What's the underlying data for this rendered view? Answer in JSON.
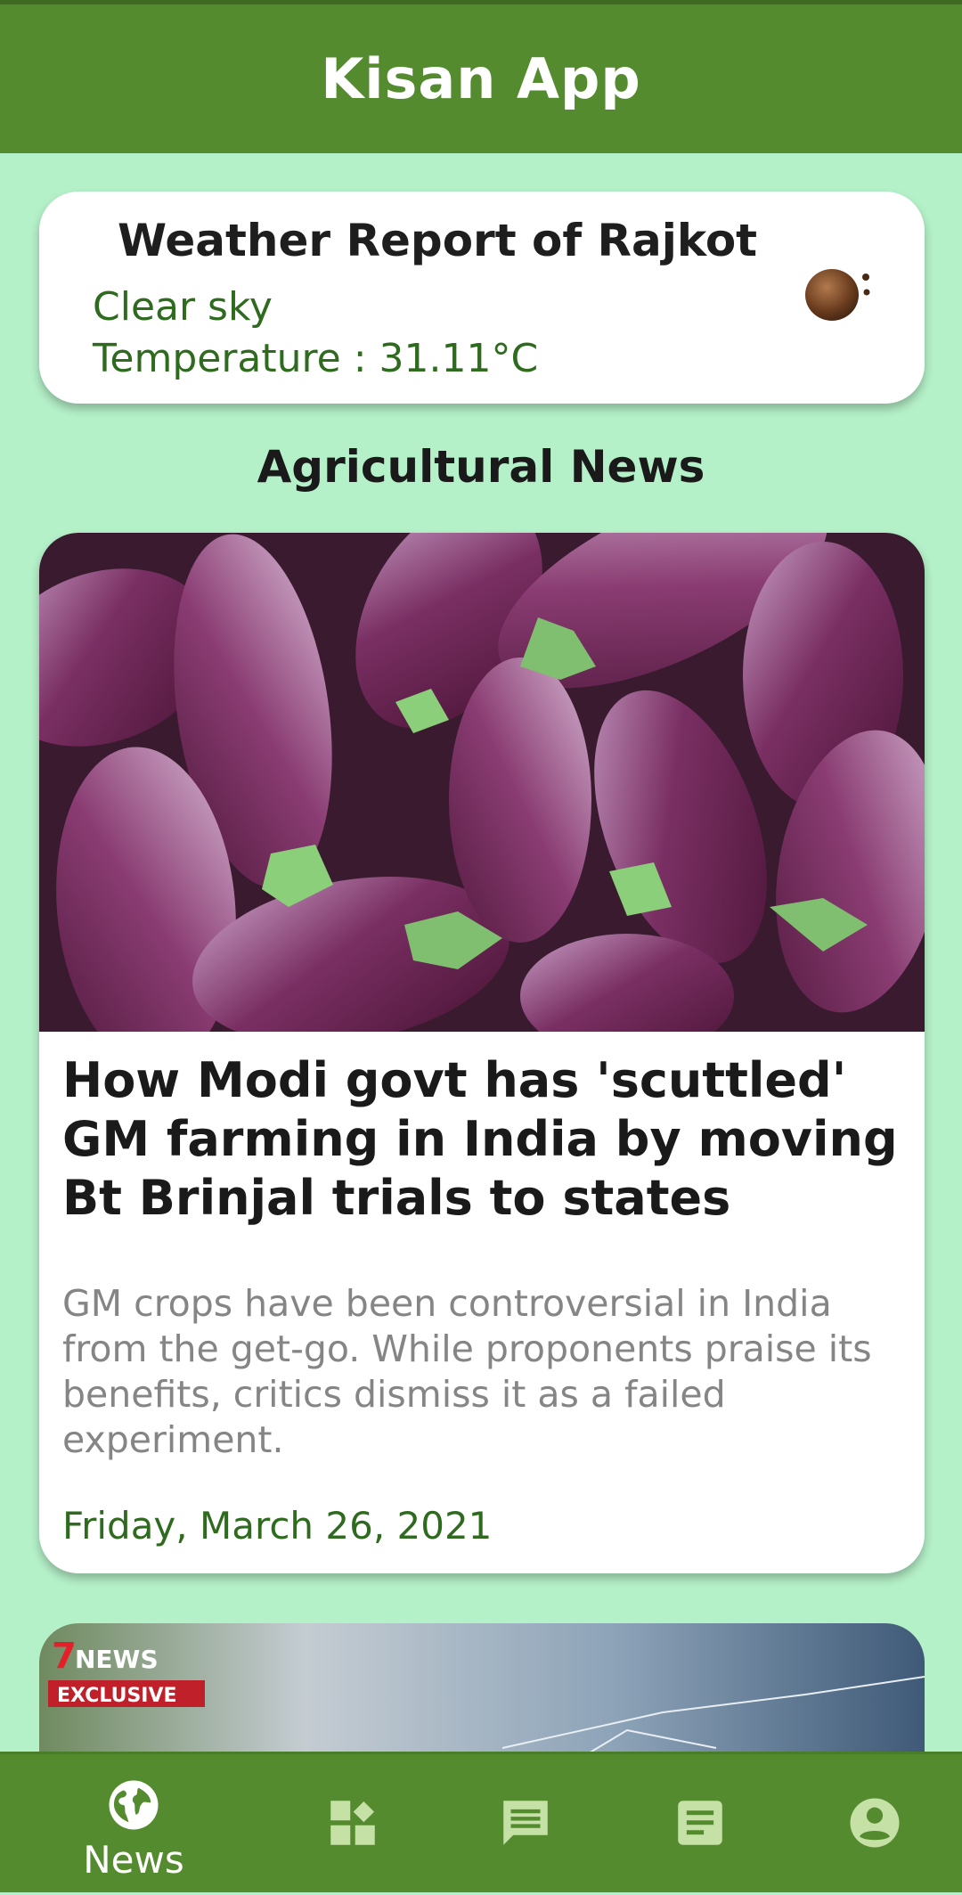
{
  "app": {
    "title": "Kisan App"
  },
  "weather": {
    "title": "Weather Report of Rajkot",
    "condition": "Clear sky",
    "temperature": "Temperature : 31.11°C",
    "icon": "clear-sky-weather-icon"
  },
  "section": {
    "title": "Agricultural News"
  },
  "articles": [
    {
      "headline": "How Modi govt has 'scuttled' GM farming in India by moving Bt Brinjal trials to states",
      "summary": "GM crops have been controversial in India from the get-go. While proponents praise its benefits, critics dismiss it as a failed experiment.",
      "date": "Friday, March 26, 2021",
      "image": "brinjal-photo"
    },
    {
      "badge_brand": "NEWS",
      "badge_label": "EXCLUSIVE",
      "image": "cracked-windshield-photo"
    }
  ],
  "bottom_nav": {
    "items": [
      {
        "label": "News",
        "icon": "globe-icon",
        "active": true
      },
      {
        "label": "",
        "icon": "dashboard-icon",
        "active": false
      },
      {
        "label": "",
        "icon": "chat-icon",
        "active": false
      },
      {
        "label": "",
        "icon": "article-icon",
        "active": false
      },
      {
        "label": "",
        "icon": "account-icon",
        "active": false
      }
    ]
  },
  "colors": {
    "primary": "#558b2f",
    "background": "#b4f0c8",
    "accent_text": "#2e6b1e"
  }
}
